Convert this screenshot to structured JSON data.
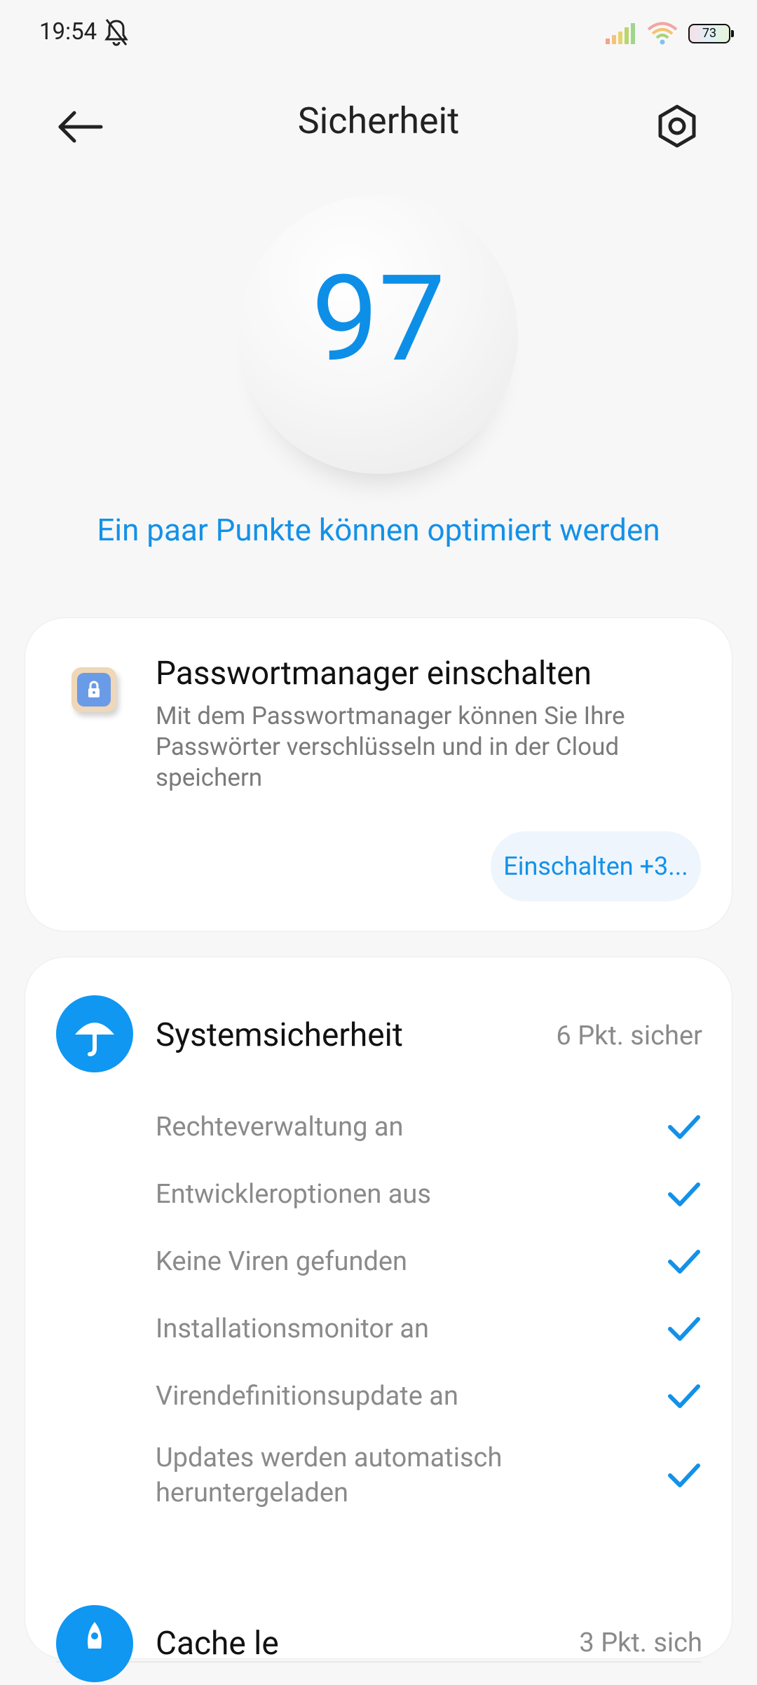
{
  "status_bar": {
    "time": "19:54",
    "battery_level": "73",
    "icons": [
      "bell-off-icon",
      "signal-icon",
      "wifi-icon",
      "battery-icon"
    ]
  },
  "header": {
    "title": "Sicherheit",
    "back_icon": "arrow-left-icon",
    "settings_icon": "settings-gear-icon"
  },
  "score": {
    "value": "97",
    "subtitle": "Ein paar Punkte können optimiert werden"
  },
  "password_card": {
    "title": "Passwortmanager einschalten",
    "description": "Mit dem Passwortmanager können Sie Ihre Passwörter verschlüsseln und in der Cloud speichern",
    "button_label": "Einschalten +3..."
  },
  "system_security": {
    "title": "Systemsicherheit",
    "status": "6 Pkt. sicher",
    "items": [
      {
        "label": "Rechteverwaltung an"
      },
      {
        "label": "Entwickleroptionen aus"
      },
      {
        "label": "Keine Viren gefunden"
      },
      {
        "label": "Installationsmonitor an"
      },
      {
        "label": "Virendefinitionsupdate an"
      },
      {
        "label": "Updates werden automatisch heruntergeladen"
      }
    ]
  },
  "next_section": {
    "title": "Cache le",
    "status": "3 Pkt. sich"
  },
  "colors": {
    "accent": "#1391e8",
    "background": "#f7f7f7",
    "card": "#ffffff"
  }
}
